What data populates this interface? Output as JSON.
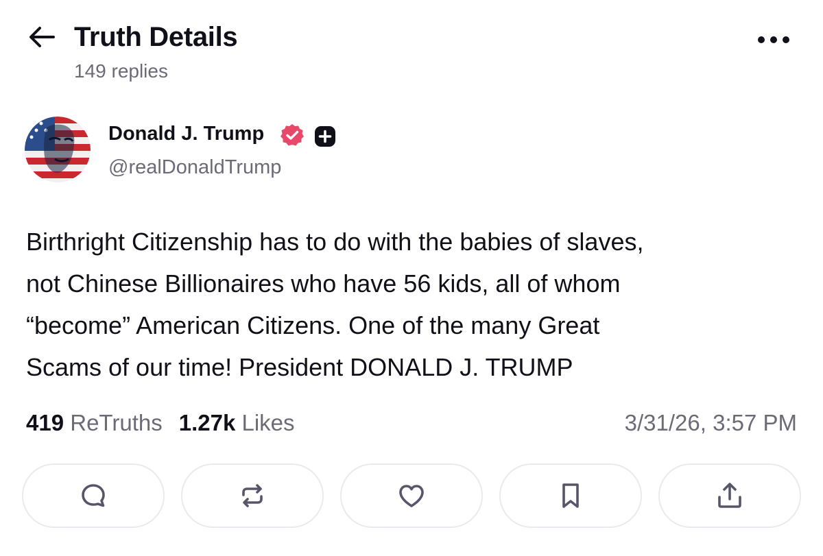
{
  "header": {
    "title": "Truth Details",
    "subtitle": "149 replies",
    "back_icon": "arrow-left-icon",
    "more_icon": "more-horizontal-icon"
  },
  "post": {
    "author": {
      "name": "Donald J. Trump",
      "handle": "@realDonaldTrump",
      "verified_badge": "verified-badge-icon",
      "verified_color": "#e8496a",
      "plus_badge": "plus-badge-icon"
    },
    "body": "Birthright Citizenship has to do with the babies of slaves,\nnot Chinese Billionaires who have 56 kids, all of whom\n“become” American Citizens. One of the many Great\nScams of our time! President DONALD J. TRUMP",
    "stats": {
      "retruths_count": "419",
      "retruths_label": "ReTruths",
      "likes_count": "1.27k",
      "likes_label": "Likes"
    },
    "timestamp": "3/31/26, 3:57 PM"
  },
  "actions": [
    {
      "icon": "reply-icon"
    },
    {
      "icon": "retruth-icon"
    },
    {
      "icon": "like-heart-icon"
    },
    {
      "icon": "bookmark-icon"
    },
    {
      "icon": "share-icon"
    }
  ],
  "colors": {
    "text_primary": "#101019",
    "text_secondary": "#6b6b78",
    "border": "#e9e9ee",
    "icon": "#56566a",
    "verified": "#e8496a"
  }
}
